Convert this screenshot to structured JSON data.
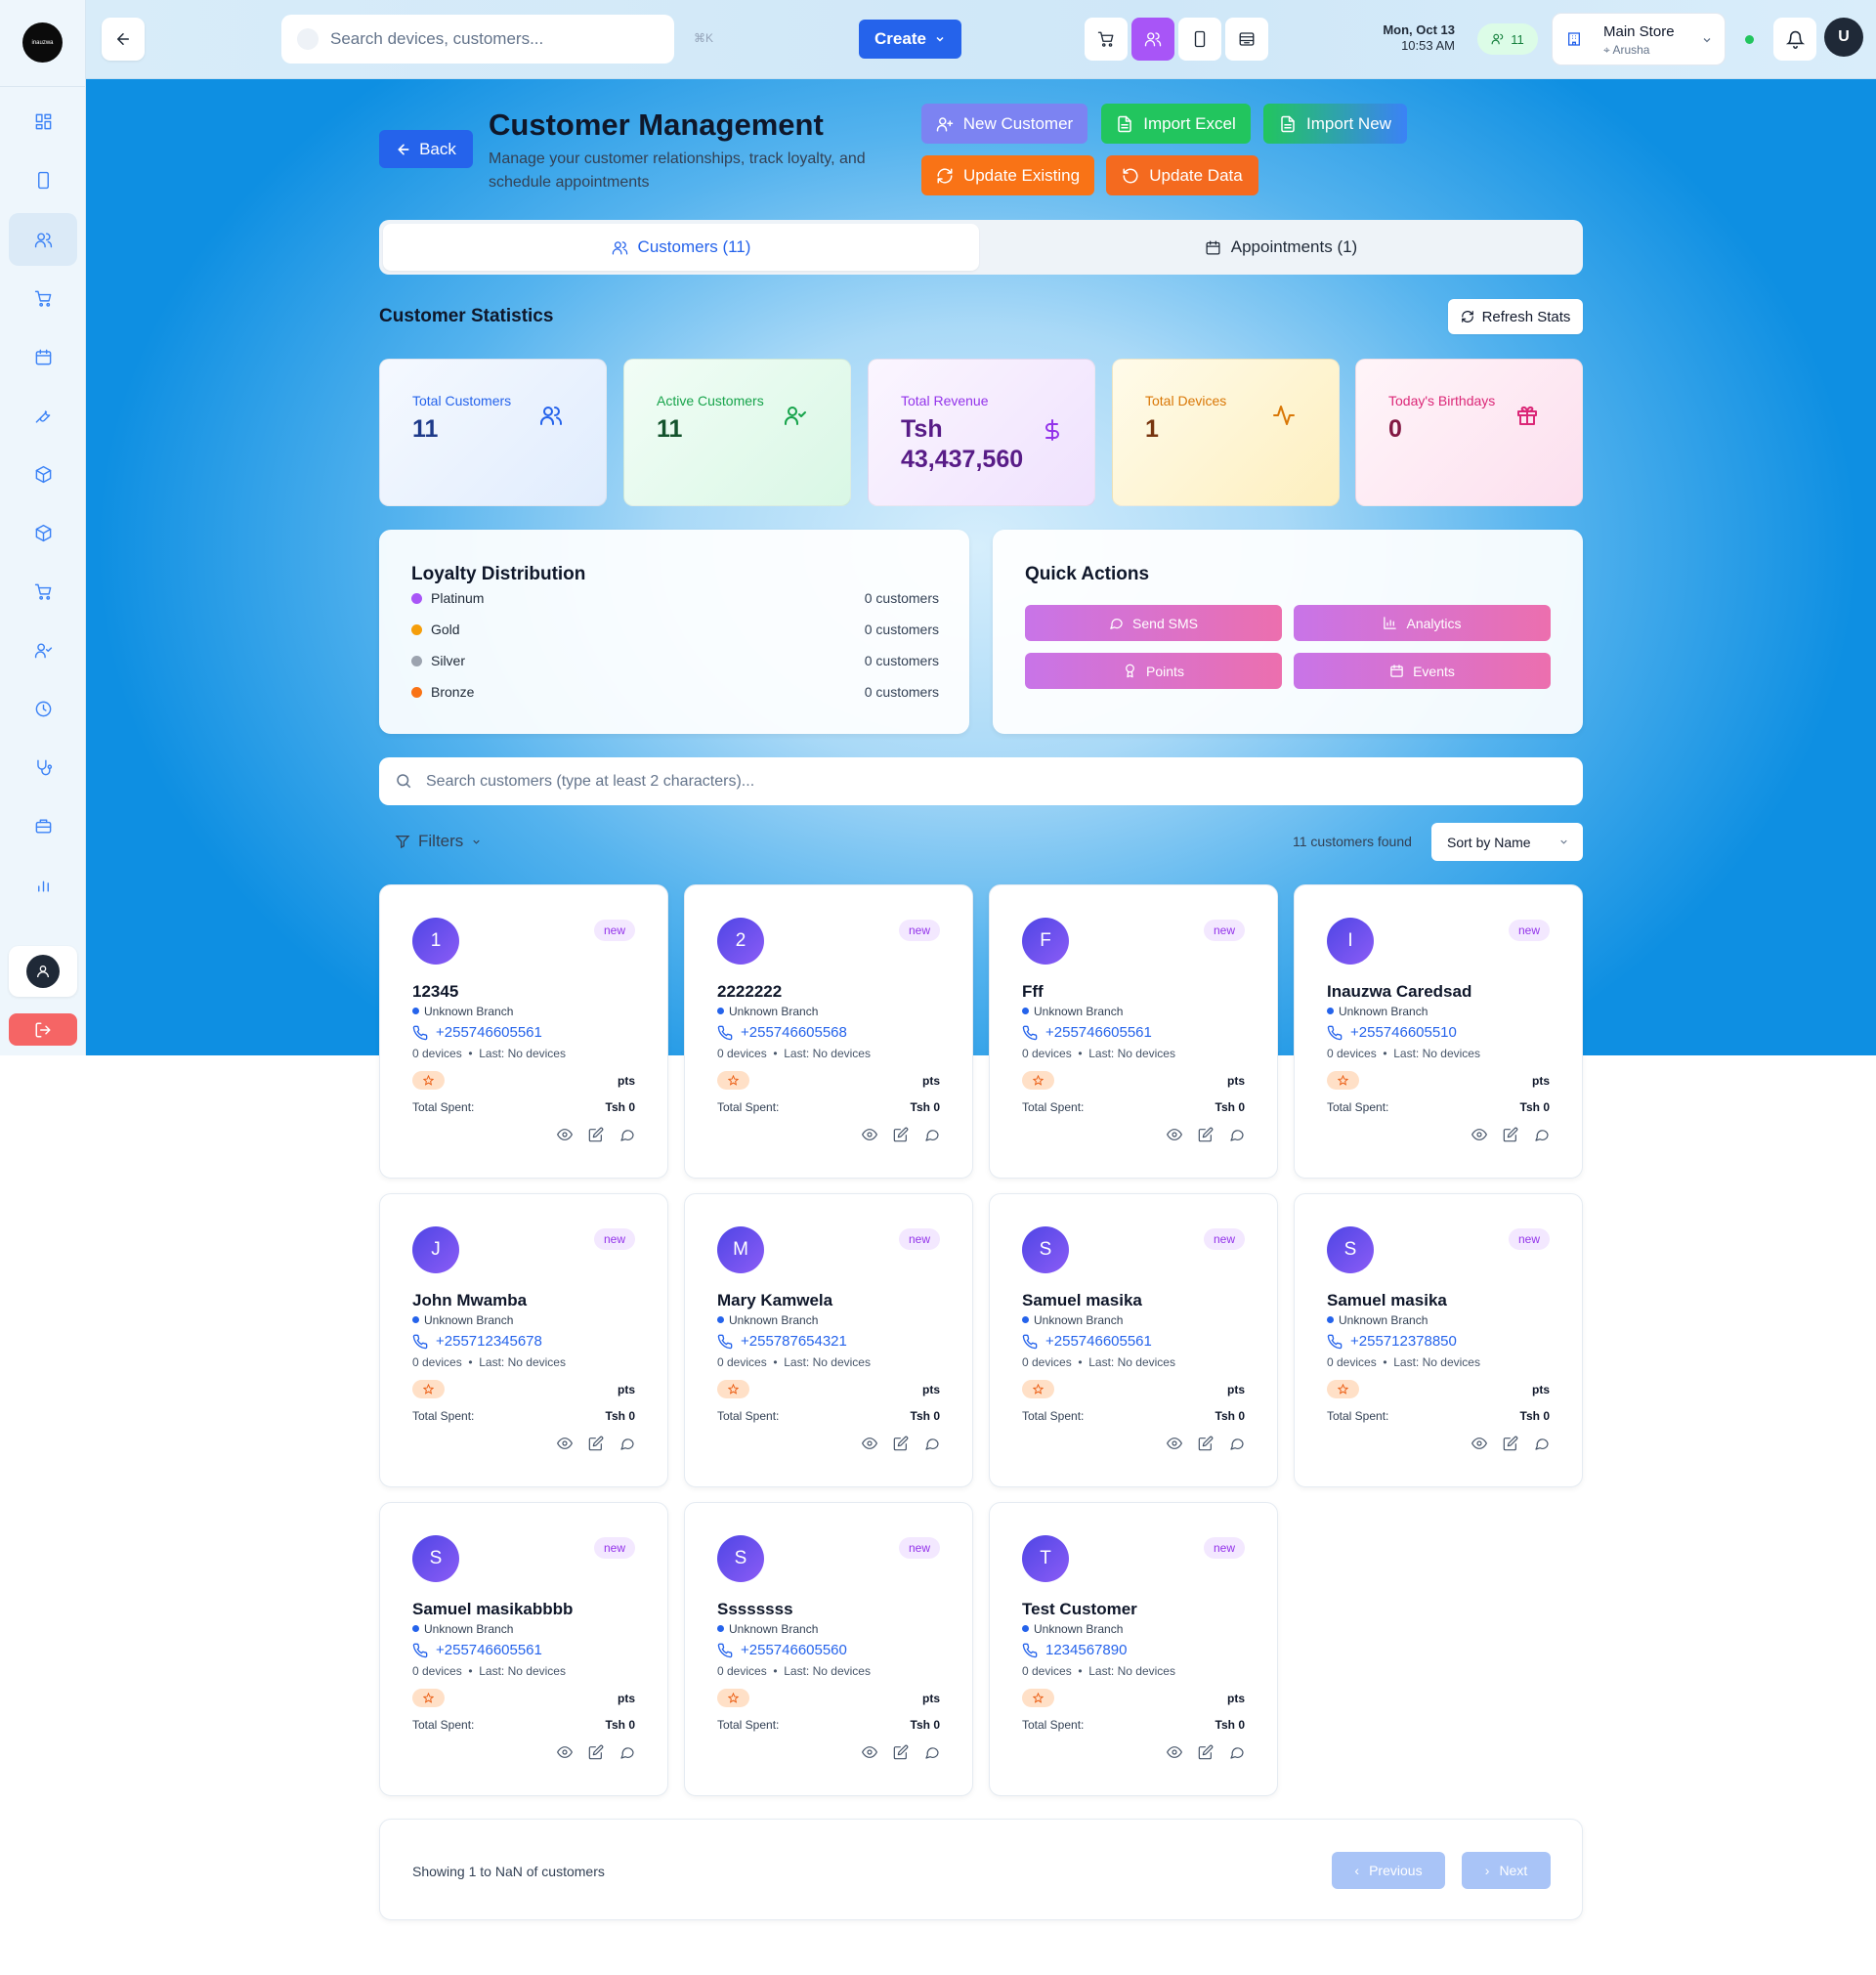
{
  "sidebar": {
    "logo_text": "inauzwa",
    "items": [
      "dashboard-icon",
      "device-icon",
      "customers-icon",
      "cart-icon",
      "calendar-icon",
      "wrench-icon",
      "package-icon",
      "box-icon",
      "cart-icon",
      "user-check-icon",
      "clock-icon",
      "stethoscope-icon",
      "briefcase-icon",
      "bar-chart-icon"
    ],
    "active_index": 2
  },
  "topbar": {
    "search_placeholder": "Search devices, customers...",
    "shortcut": "⌘K",
    "create_label": "Create",
    "date": "Mon, Oct 13",
    "time": "10:53 AM",
    "online_count": "11",
    "store_name": "Main Store",
    "store_location": "Arusha",
    "avatar_initial": "U"
  },
  "header": {
    "back_label": "Back",
    "title": "Customer Management",
    "subtitle": "Manage your customer relationships, track loyalty, and schedule appointments",
    "actions": {
      "new_customer": "New Customer",
      "import_excel": "Import Excel",
      "import_new": "Import New",
      "update_existing": "Update Existing",
      "update_data": "Update Data"
    }
  },
  "tabs": {
    "customers": "Customers (11)",
    "appointments": "Appointments (1)"
  },
  "stats": {
    "section_title": "Customer Statistics",
    "refresh_label": "Refresh Stats",
    "total_customers": {
      "label": "Total Customers",
      "value": "11"
    },
    "active_customers": {
      "label": "Active Customers",
      "value": "11"
    },
    "total_revenue": {
      "label": "Total Revenue",
      "value": "Tsh 43,437,560"
    },
    "total_devices": {
      "label": "Total Devices",
      "value": "1"
    },
    "todays_birthdays": {
      "label": "Today's Birthdays",
      "value": "0"
    }
  },
  "loyalty": {
    "title": "Loyalty Distribution",
    "tiers": [
      {
        "name": "Platinum",
        "count": "0 customers",
        "color": "#a855f7"
      },
      {
        "name": "Gold",
        "count": "0 customers",
        "color": "#f59e0b"
      },
      {
        "name": "Silver",
        "count": "0 customers",
        "color": "#9ca3af"
      },
      {
        "name": "Bronze",
        "count": "0 customers",
        "color": "#f97316"
      }
    ]
  },
  "quick_actions": {
    "title": "Quick Actions",
    "send_sms": "Send SMS",
    "analytics": "Analytics",
    "points": "Points",
    "events": "Events"
  },
  "customer_search": {
    "placeholder": "Search customers (type at least 2 characters)..."
  },
  "filters": {
    "label": "Filters",
    "found": "11 customers found",
    "sort": "Sort by Name"
  },
  "customers": [
    {
      "initial": "1",
      "name": "12345",
      "phone": "+255746605561"
    },
    {
      "initial": "2",
      "name": "2222222",
      "phone": "+255746605568"
    },
    {
      "initial": "F",
      "name": "Fff",
      "phone": "+255746605561"
    },
    {
      "initial": "I",
      "name": "Inauzwa Caredsad",
      "phone": "+255746605510"
    },
    {
      "initial": "J",
      "name": "John Mwamba",
      "phone": "+255712345678"
    },
    {
      "initial": "M",
      "name": "Mary Kamwela",
      "phone": "+255787654321"
    },
    {
      "initial": "S",
      "name": "Samuel masika",
      "phone": "+255746605561"
    },
    {
      "initial": "S",
      "name": "Samuel masika",
      "phone": "+255712378850"
    },
    {
      "initial": "S",
      "name": "Samuel masikabbbb",
      "phone": "+255746605561"
    },
    {
      "initial": "S",
      "name": "Ssssssss",
      "phone": "+255746605560"
    },
    {
      "initial": "T",
      "name": "Test Customer",
      "phone": "1234567890"
    }
  ],
  "card_common": {
    "badge": "new",
    "branch": "Unknown Branch",
    "devices": "0 devices",
    "last": "Last: No devices",
    "points_label": "pts",
    "total_spent_label": "Total Spent:",
    "total_spent_value": "Tsh 0"
  },
  "pagination": {
    "showing": "Showing 1 to NaN of customers",
    "previous": "Previous",
    "next": "Next"
  },
  "colors": {
    "primary": "#2563eb",
    "purple": "#a855f7",
    "orange": "#f97316",
    "green": "#22c55e"
  }
}
